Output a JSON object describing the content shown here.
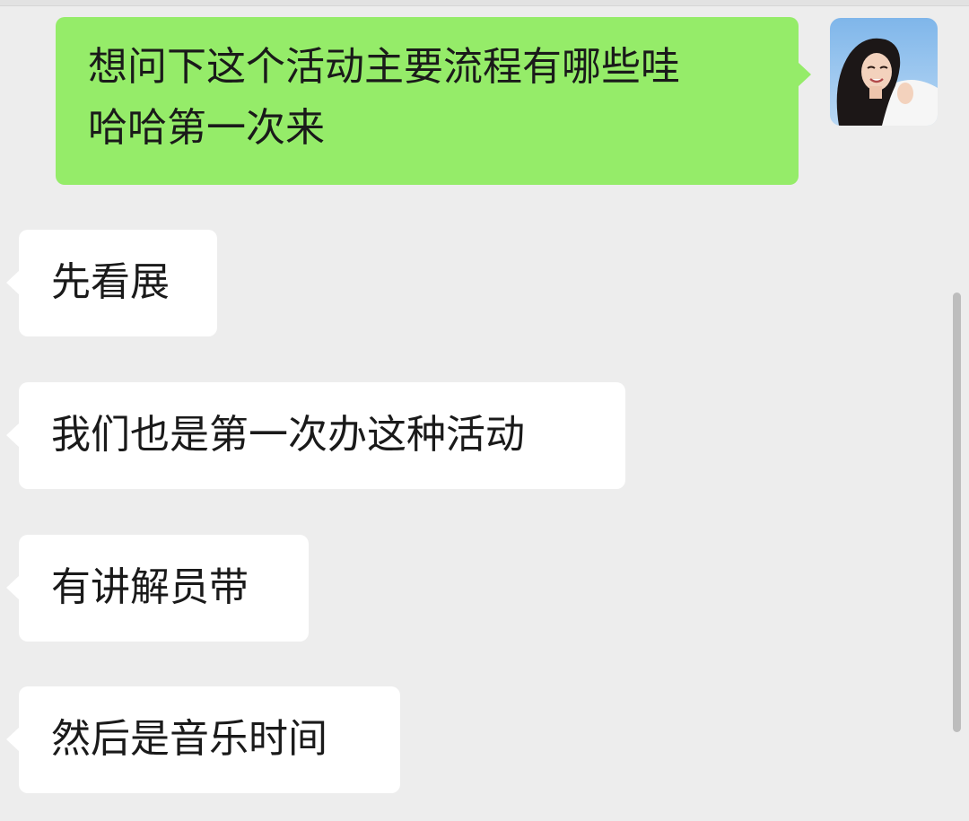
{
  "chat": {
    "outgoing": [
      {
        "text": "想问下这个活动主要流程有哪些哇\n哈哈第一次来"
      }
    ],
    "incoming": [
      {
        "text": "先看展"
      },
      {
        "text": "我们也是第一次办这种活动"
      },
      {
        "text": "有讲解员带"
      },
      {
        "text": "然后是音乐时间"
      }
    ]
  },
  "colors": {
    "background": "#ededed",
    "outgoing_bubble": "#95ec69",
    "incoming_bubble": "#ffffff"
  },
  "icons": {
    "avatar": "user-avatar-photo"
  }
}
